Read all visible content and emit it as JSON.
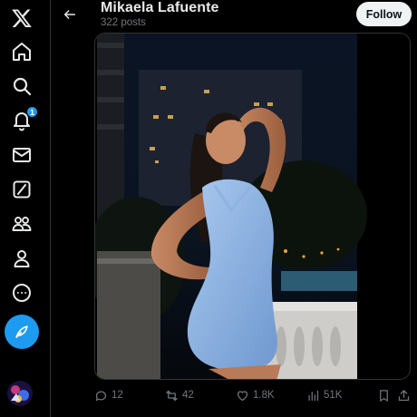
{
  "header": {
    "profile_name": "Mikaela Lafuente",
    "post_count": "322 posts",
    "follow_label": "Follow"
  },
  "nav": {
    "notifications_badge": "1",
    "items": [
      "x-logo-icon",
      "home-icon",
      "search-icon",
      "bell-icon",
      "mail-icon",
      "grok-icon",
      "communities-icon",
      "profile-icon",
      "more-icon"
    ]
  },
  "media": {
    "description_icon": "photo"
  },
  "actions": {
    "replies": "12",
    "reposts": "42",
    "likes": "1.8K",
    "views": "51K"
  },
  "colors": {
    "accent": "#1d9bf0",
    "background": "#000000",
    "muted_text": "#71767b",
    "border": "#2f3336"
  }
}
